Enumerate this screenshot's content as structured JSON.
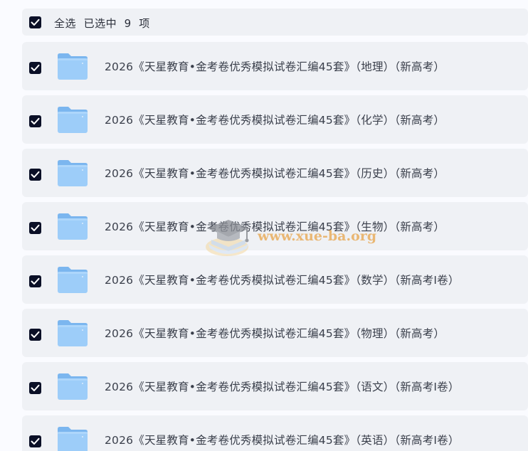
{
  "header": {
    "select_all_label": "全选",
    "selected_prefix": "已选中",
    "selected_count": "9",
    "selected_suffix": "项"
  },
  "files": [
    {
      "name": "2026《天星教育•金考卷优秀模拟试卷汇编45套》（地理）（新高考）",
      "checked": true
    },
    {
      "name": "2026《天星教育•金考卷优秀模拟试卷汇编45套》（化学）（新高考）",
      "checked": true
    },
    {
      "name": "2026《天星教育•金考卷优秀模拟试卷汇编45套》（历史）（新高考）",
      "checked": true
    },
    {
      "name": "2026《天星教育•金考卷优秀模拟试卷汇编45套》（生物）（新高考）",
      "checked": true
    },
    {
      "name": "2026《天星教育•金考卷优秀模拟试卷汇编45套》（数学）（新高考Ⅰ卷）",
      "checked": true
    },
    {
      "name": "2026《天星教育•金考卷优秀模拟试卷汇编45套》（物理）（新高考）",
      "checked": true
    },
    {
      "name": "2026《天星教育•金考卷优秀模拟试卷汇编45套》（语文）（新高考Ⅰ卷）",
      "checked": true
    },
    {
      "name": "2026《天星教育•金考卷优秀模拟试卷汇编45套》（英语）（新高考Ⅰ卷）",
      "checked": true
    }
  ],
  "watermark": {
    "text": "www.xue-ba.org"
  },
  "colors": {
    "checkbox": "#0b1027",
    "row_background": "#eff1f5",
    "folder": "#8ec5f7"
  }
}
